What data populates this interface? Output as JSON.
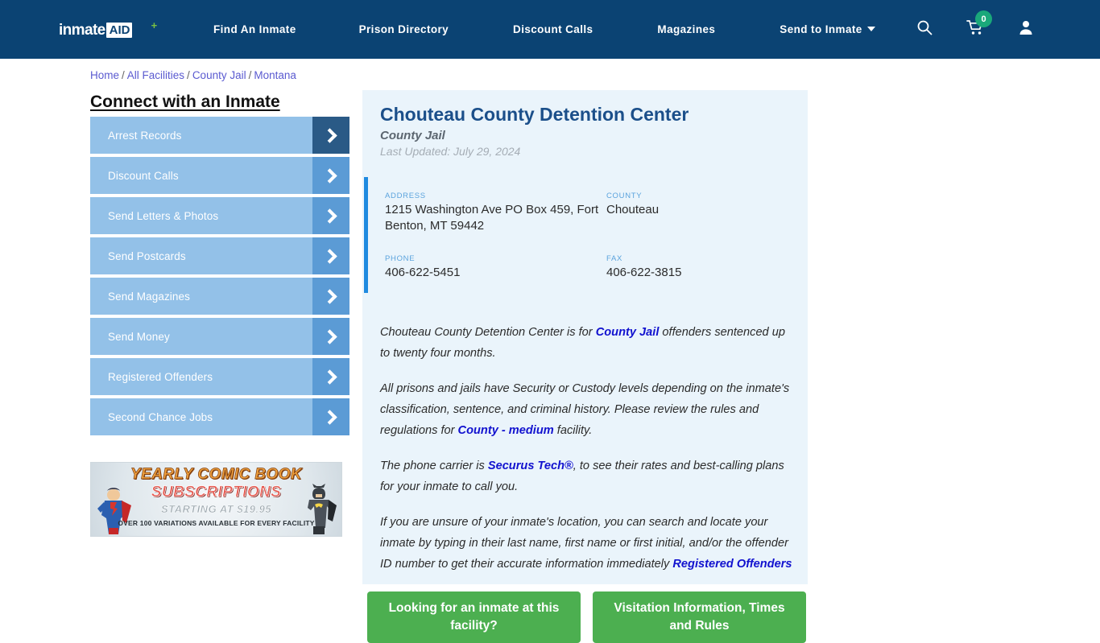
{
  "header": {
    "logo": {
      "word": "inmate",
      "badge": "AID",
      "plus": "+"
    },
    "nav": [
      {
        "label": "Find An Inmate"
      },
      {
        "label": "Prison Directory"
      },
      {
        "label": "Discount Calls"
      },
      {
        "label": "Magazines"
      },
      {
        "label": "Send to Inmate"
      }
    ],
    "icons": {
      "search": "search-icon",
      "cart": "cart-icon",
      "cart_count": "0",
      "user": "user-icon"
    },
    "colors": {
      "bar": "#0b4373",
      "badge": "#1aa87a"
    }
  },
  "breadcrumb": {
    "items": [
      "Home",
      "All Facilities",
      "County Jail",
      "Montana"
    ],
    "separator": "/"
  },
  "sidebar": {
    "title": "Connect with an Inmate",
    "items": [
      {
        "label": "Arrest Records"
      },
      {
        "label": "Discount Calls"
      },
      {
        "label": "Send Letters & Photos"
      },
      {
        "label": "Send Postcards"
      },
      {
        "label": "Send Magazines"
      },
      {
        "label": "Send Money"
      },
      {
        "label": "Registered Offenders"
      },
      {
        "label": "Second Chance Jobs"
      }
    ]
  },
  "ad": {
    "line1": "YEARLY COMIC BOOK",
    "line2": "SUBSCRIPTIONS",
    "line3": "STARTING AT $19.95",
    "line4": "OVER 100 VARIATIONS AVAILABLE FOR EVERY FACILITY"
  },
  "facility": {
    "name": "Chouteau County Detention Center",
    "type": "County Jail",
    "last_updated": "Last Updated: July 29, 2024",
    "fields": {
      "address_label": "ADDRESS",
      "address_value": "1215 Washington Ave PO Box 459, Fort Benton, MT 59442",
      "county_label": "COUNTY",
      "county_value": "Chouteau",
      "phone_label": "PHONE",
      "phone_value": "406-622-5451",
      "fax_label": "FAX",
      "fax_value": "406-622-3815"
    }
  },
  "body": {
    "p1_a": "Chouteau County Detention Center is for ",
    "p1_link": "County Jail",
    "p1_b": " offenders sentenced up to twenty four months.",
    "p2_a": "All prisons and jails have Security or Custody levels depending on the inmate's classification, sentence, and criminal history. Please review the rules and regulations for ",
    "p2_link": "County - medium",
    "p2_b": " facility.",
    "p3_a": "The phone carrier is ",
    "p3_link": "Securus Tech®",
    "p3_b": ", to see their rates and best-calling plans for your inmate to call you.",
    "p4_a": "If you are unsure of your inmate's location, you can search and locate your inmate by typing in their last name, first name or first initial, and/or the offender ID number to get their accurate information immediately ",
    "p4_link": "Registered Offenders"
  },
  "cta": {
    "left": "Looking for an inmate at this facility?",
    "right": "Visitation Information, Times and Rules"
  }
}
